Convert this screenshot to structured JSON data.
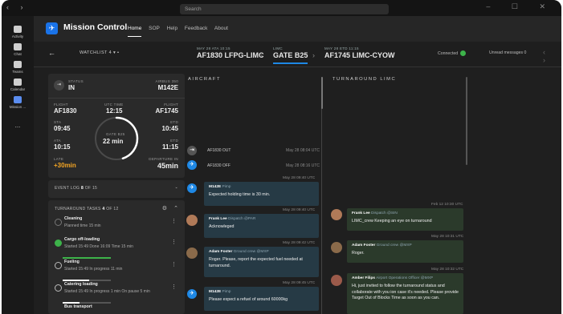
{
  "titlebar": {
    "search_placeholder": "Search",
    "nav": "‹ ›",
    "controls": "– ☐ ✕"
  },
  "rail": [
    {
      "label": "Activity"
    },
    {
      "label": "Chat"
    },
    {
      "label": "Teams"
    },
    {
      "label": "Calendar"
    },
    {
      "label": "Mission ..."
    },
    {
      "label": "..."
    }
  ],
  "app": {
    "name": "Mission Control",
    "menu": [
      "Home",
      "SOP",
      "Help",
      "Feedback",
      "About"
    ]
  },
  "subhead": {
    "watchlist": "WATCHLIST 4",
    "segments": [
      {
        "small": "MAY 28 ATA 10:15",
        "big": "AF1830 LFPG-LIMC"
      },
      {
        "small": "LIMC",
        "big": "GATE B25"
      },
      {
        "small": "MAY 28 ETD 11:15",
        "big": "AF1745 LIMC-CYOW"
      }
    ],
    "connected": "Connected",
    "unread": "Unread messages 0"
  },
  "status": {
    "label": "STATUS",
    "value": "IN",
    "aircraft_label": "AIRBUS 350",
    "aircraft": "M142E",
    "flight_in_label": "FLIGHT",
    "flight_in": "AF1830",
    "utc_label": "UTC TIME",
    "utc": "12:15",
    "flight_out_label": "FLIGHT",
    "flight_out": "AF1745",
    "sta_label": "STA",
    "sta": "09:45",
    "etd_label": "ETD",
    "etd": "10:45",
    "ata_label": "ATA",
    "ata": "10:15",
    "etd2_label": "ETD",
    "etd2": "11:15",
    "late_label": "LATE",
    "late": "+30min",
    "dep_label": "DEPARTURE IN",
    "dep": "45min",
    "gauge_label": "GATE B25",
    "gauge_value": "22 min",
    "gauge_progress": 0.45
  },
  "eventlog": {
    "label": "EVENT LOG",
    "count": "8",
    "of": "OF 15"
  },
  "tasks": {
    "label": "TURNAROUND TASKS",
    "count": "4",
    "of": "OF 12",
    "items": [
      {
        "title": "Cleaning",
        "meta": "Planned time 15 min",
        "progress": 0
      },
      {
        "title": "Cargo off-loading",
        "meta": "Started 15:49   Done 16:09   Time 15 min",
        "progress": 1
      },
      {
        "title": "Fueling",
        "meta": "Started 15:49   In progress 11 min",
        "progress": 0.55
      },
      {
        "title": "Catering loading",
        "meta": "Started 15:49   In progress 1 min   On pause 5 min",
        "progress": 0.35
      },
      {
        "title": "Bus transport",
        "meta": "",
        "progress": 0
      }
    ]
  },
  "aircraft": {
    "header": "AIRCRAFT",
    "events": [
      {
        "name": "AF1830 OUT",
        "time": "May 28 08:04 UTC"
      },
      {
        "name": "AF1830 OFF",
        "time": "May 28 08:16 UTC"
      }
    ],
    "messages": [
      {
        "ts": "May 28 09:40 UTC",
        "who": "M142E",
        "role": "Pimp",
        "text": "Expected holding time is 30 min."
      },
      {
        "ts": "May 28 09:40 UTC",
        "who": "Frank Lee",
        "role": "Dispatch @PAR",
        "text": "Acknowleged"
      },
      {
        "ts": "May 28 09:42 UTC",
        "who": "Adam Foster",
        "role": "Ground crew @MXP",
        "text": "Roger. Please, report the expected fuel needed at turnaround."
      },
      {
        "ts": "May 28 09:45 UTC",
        "who": "M142E",
        "role": "Pimp",
        "text": "Please expect a refuel of around 60000kg"
      }
    ]
  },
  "turnaround": {
    "header": "TURNAROUND LIMC",
    "messages": [
      {
        "ts": "Feb 12 10:30 UTC",
        "who": "Frank Lee",
        "role": "Dispatch @SIN",
        "text": "LIMC_crew Keeping an eye on turnaround"
      },
      {
        "ts": "May 28 10:31 UTC",
        "who": "Adam Foster",
        "role": "Ground crew @MXP",
        "text": "Roger."
      },
      {
        "ts": "May 28 10:32 UTC",
        "who": "Amber Filips",
        "role": "Airport Operations Officer @MXP",
        "text": "Hi, just invited to follow the turnaround status and collaborate with you ion case it's needed. Please provide Target Out of Blocks Time as soon as you can."
      }
    ]
  }
}
